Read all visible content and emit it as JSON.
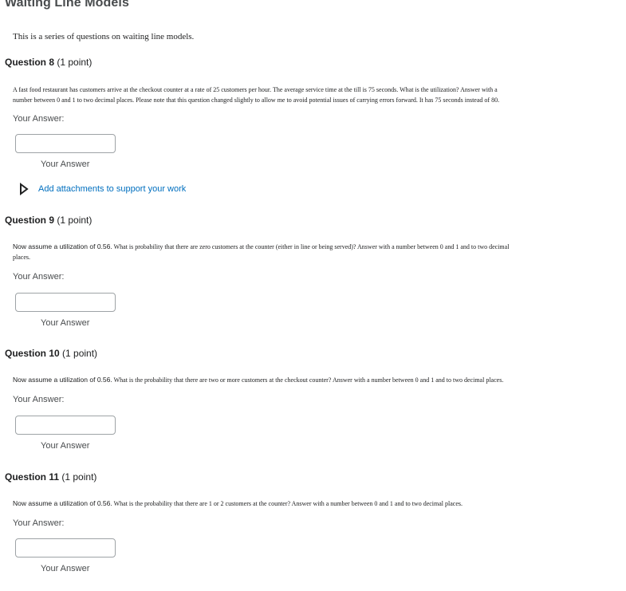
{
  "page": {
    "title": "Waiting Line Models",
    "intro": "This is a series of questions on waiting line models."
  },
  "labels": {
    "your_answer": "Your Answer:",
    "answer_caption": "Your Answer",
    "attachments": "Add attachments to support your work"
  },
  "icons": {
    "attachments_toggle": "caret-right-icon"
  },
  "colors": {
    "link": "#006fbf",
    "heading": "#494c4e",
    "input_border": "#9ea3a6"
  },
  "questions": [
    {
      "number": "Question 8",
      "points": "(1 point)",
      "text_line1": "A fast food restaurant has customers arrive at the checkout counter at a rate of 25 customers per hour.  The average service time at the till is 75 seconds. What is the utilization? Answer with a",
      "text_line2": "number between 0 and 1 to two decimal places.  Please note that this question changed slightly to allow me to avoid potential issues of carrying errors forward.  It has 75 seconds instead of 80.",
      "answer_value": ""
    },
    {
      "number": "Question 9",
      "points": "(1 point)",
      "text_lead": "Now assume a utilization of 0.56.",
      "text_line1": "  What is probability that there are zero customers at the counter (either in line or being served)?  Answer with a number between 0 and 1 and to two decimal",
      "text_line2": "places.",
      "answer_value": ""
    },
    {
      "number": "Question 10",
      "points": "(1 point)",
      "text_lead": "Now assume a utilization of 0.56.",
      "text_line1": "  What is the probability that there are two or more customers at the checkout counter?  Answer with a number between 0 and 1 and to two decimal places.",
      "answer_value": ""
    },
    {
      "number": "Question 11",
      "points": "(1 point)",
      "text_lead": "Now assume a utilization of 0.56.",
      "text_line1": "  What is the probability that there are 1 or 2 customers at the counter?   Answer with a number between 0 and 1 and to two decimal places.",
      "answer_value": ""
    }
  ]
}
